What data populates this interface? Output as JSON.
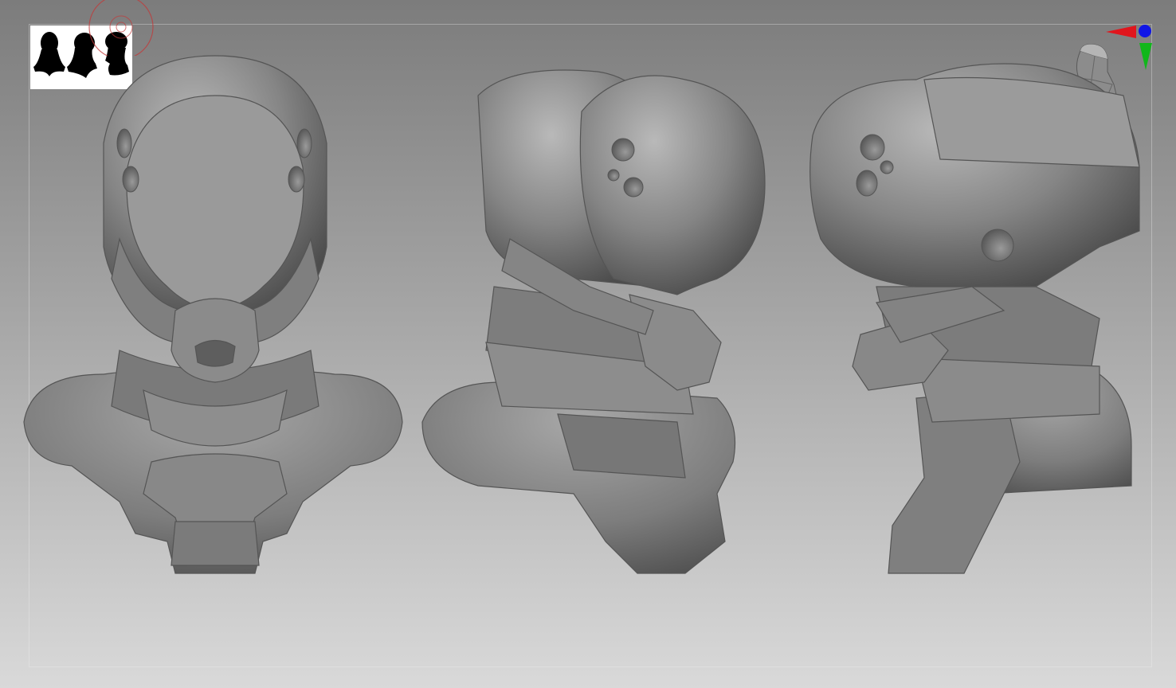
{
  "scene": {
    "views": [
      {
        "name": "front"
      },
      {
        "name": "three-quarter"
      },
      {
        "name": "side"
      }
    ],
    "icons": {
      "thumbnail": "silhouette-thumbnail-icon",
      "brush": "brush-cursor-icon",
      "gizmo": "axis-gizmo-icon"
    },
    "colors": {
      "background_top": "#7c7c7c",
      "background_bottom": "#d9d9d9",
      "model": "#8a8a8a",
      "axis_x": "#e0161d",
      "axis_y": "#11b71b",
      "axis_z": "#1016e6",
      "brush": "#c23a3a"
    }
  }
}
